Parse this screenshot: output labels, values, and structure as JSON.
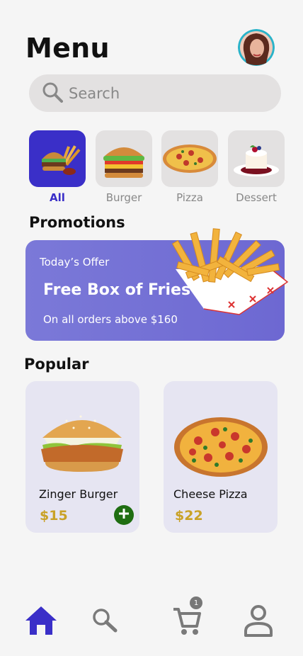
{
  "header": {
    "title": "Menu"
  },
  "search": {
    "placeholder": "Search"
  },
  "categories": [
    {
      "label": "All",
      "active": true
    },
    {
      "label": "Burger",
      "active": false
    },
    {
      "label": "Pizza",
      "active": false
    },
    {
      "label": "Dessert",
      "active": false
    }
  ],
  "promotions": {
    "heading": "Promotions",
    "offer_label": "Today’s Offer",
    "headline": "Free Box of Fries",
    "subtext": "On all orders above $160"
  },
  "popular": {
    "heading": "Popular",
    "items": [
      {
        "name": "Zinger Burger",
        "price": "$15"
      },
      {
        "name": "Cheese Pizza",
        "price": "$22"
      }
    ]
  },
  "nav": {
    "items": [
      "home-icon",
      "search-icon",
      "cart-icon",
      "profile-icon"
    ],
    "cart_count": "1"
  },
  "colors": {
    "accent": "#3a2fc8",
    "promo": "#7370d6",
    "price": "#c9a227",
    "add": "#1f6e12"
  }
}
